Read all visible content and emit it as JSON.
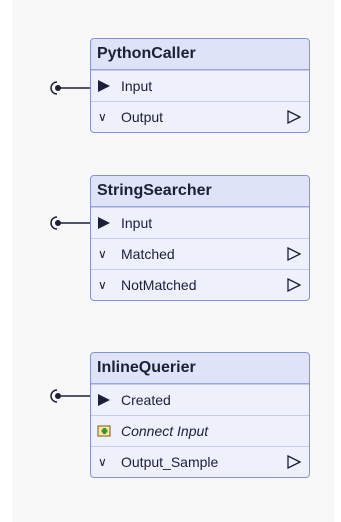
{
  "nodes": [
    {
      "title": "PythonCaller",
      "input": "Input",
      "outputs": [
        "Output"
      ]
    },
    {
      "title": "StringSearcher",
      "input": "Input",
      "outputs": [
        "Matched",
        "NotMatched"
      ]
    },
    {
      "title": "InlineQuerier",
      "input": "Created",
      "connect": "Connect Input",
      "outputs": [
        "Output_Sample"
      ]
    }
  ],
  "colors": {
    "border": "#8592d8",
    "title_bg": "#dfe3f8",
    "body_bg": "#eef0fb"
  }
}
